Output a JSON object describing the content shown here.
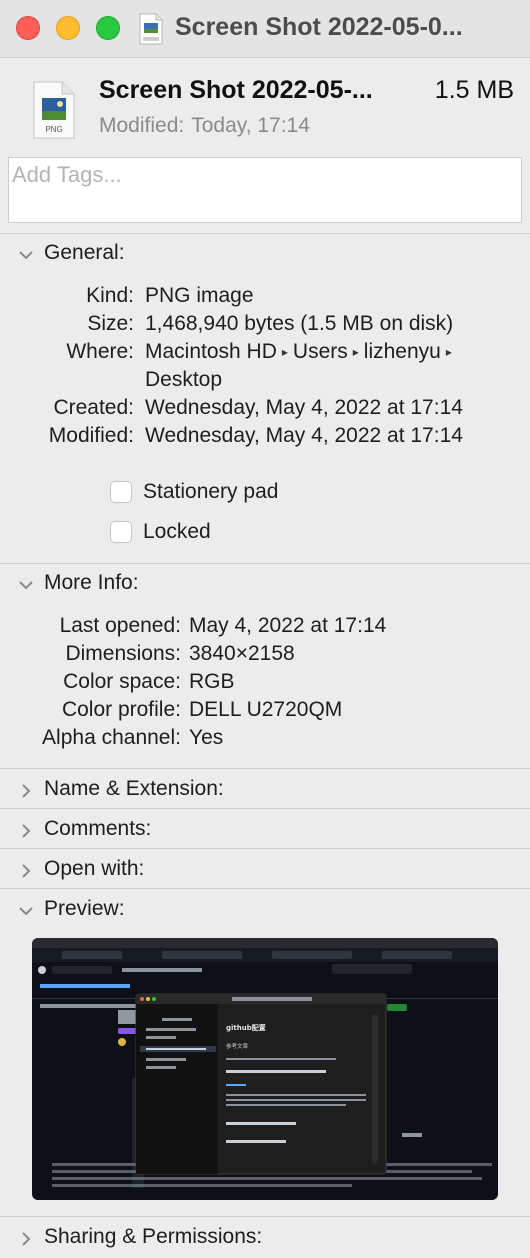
{
  "window": {
    "title": "Screen Shot 2022-05-0..."
  },
  "header": {
    "file_name": "Screen Shot 2022-05-...",
    "file_size": "1.5 MB",
    "modified_label": "Modified:",
    "modified_value": "Today, 17:14",
    "file_icon_label": "PNG"
  },
  "tags": {
    "placeholder": "Add Tags..."
  },
  "sections": {
    "general": "General:",
    "more_info": "More Info:",
    "name_extension": "Name & Extension:",
    "comments": "Comments:",
    "open_with": "Open with:",
    "preview": "Preview:",
    "sharing": "Sharing & Permissions:"
  },
  "general": {
    "kind_label": "Kind:",
    "kind_value": "PNG image",
    "size_label": "Size:",
    "size_value": "1,468,940 bytes (1.5 MB on disk)",
    "where_label": "Where:",
    "where_path": [
      "Macintosh HD",
      "Users",
      "lizhenyu",
      "Desktop"
    ],
    "created_label": "Created:",
    "created_value": "Wednesday, May 4, 2022 at 17:14",
    "modified_label": "Modified:",
    "modified_value": "Wednesday, May 4, 2022 at 17:14",
    "stationery_label": "Stationery pad",
    "stationery_checked": false,
    "locked_label": "Locked",
    "locked_checked": false
  },
  "more_info": {
    "last_opened_label": "Last opened:",
    "last_opened_value": "May 4, 2022 at 17:14",
    "dimensions_label": "Dimensions:",
    "dimensions_value": "3840×2158",
    "color_space_label": "Color space:",
    "color_space_value": "RGB",
    "color_profile_label": "Color profile:",
    "color_profile_value": "DELL U2720QM",
    "alpha_label": "Alpha channel:",
    "alpha_value": "Yes"
  },
  "preview": {
    "heading": "github配置",
    "subheading": "参考文章"
  },
  "colors": {
    "close": "#ff5f57",
    "minimize": "#febc2e",
    "maximize": "#28c840",
    "window_bg": "#ececec",
    "preview_bg": "#0d1117"
  }
}
